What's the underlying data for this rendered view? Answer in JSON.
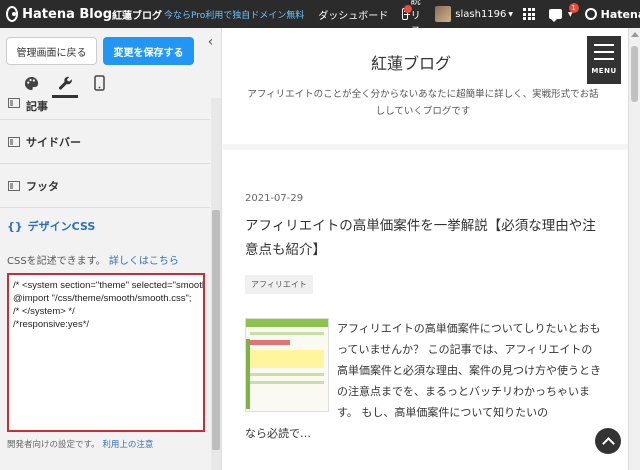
{
  "topbar": {
    "logo": "Hatena Blog",
    "blog_name": "紅蓮ブログ",
    "promo": "今ならPro利用で独自ドメイン無料",
    "dashboard": "ダッシュボード",
    "reader": "購読リスト",
    "username": "slash1196",
    "notifications": "1",
    "hatena": "Hatena"
  },
  "sidebar": {
    "back_button": "管理画面に戻る",
    "save_button": "変更を保存する",
    "menu": [
      {
        "label": "記事"
      },
      {
        "label": "サイドバー"
      },
      {
        "label": "フッタ"
      }
    ],
    "css_section": {
      "title": "デザインCSS",
      "desc": "CSSを記述できます。",
      "desc_link": "詳しくはこちら",
      "code": "/* <system section=\"theme\" selected=\"smooth\">\n@import \"/css/theme/smooth/smooth.css\";\n/* </system> */\n/*responsive:yes*/",
      "notice": "開発者向けの設定です。",
      "notice_link": "利用上の注意"
    }
  },
  "preview": {
    "blog_title": "紅蓮ブログ",
    "blog_description": "アフィリエイトのことが全く分からないあなたに超簡単に詳しく、実戦形式でお話ししていくブログです",
    "menu_label": "MENU",
    "article": {
      "date": "2021-07-29",
      "title": "アフィリエイトの高単価案件を一挙解説【必須な理由や注意点も紹介】",
      "tag": "アフィリエイト",
      "excerpt": "アフィリエイトの高単価案件についてしりたいとおもっていませんか？ この記事では、アフィリエイトの高単価案件と必須な理由、案件の見つけ方や使うときの注意点までを、まるっとバッチリわかっちゃいます。 もし、高単価案件について知りたいの",
      "excerpt_tail": "なら必読で…"
    }
  }
}
